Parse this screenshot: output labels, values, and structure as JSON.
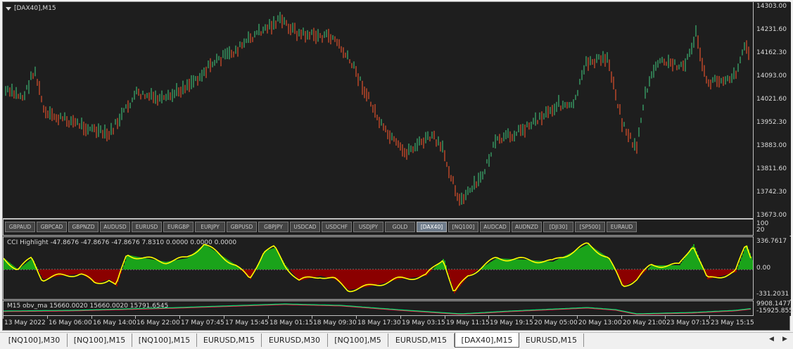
{
  "chart": {
    "title": "[DAX40],M15",
    "price_axis": [
      "14303.00",
      "14231.60",
      "14162.30",
      "14093.00",
      "14021.60",
      "13952.30",
      "13883.00",
      "13811.60",
      "13742.30",
      "13673.00"
    ],
    "symbols": [
      "GBPAUD",
      "GBPCAD",
      "GBPNZD",
      "AUDUSD",
      "EURUSD",
      "EURGBP",
      "EURJPY",
      "GBPUSD",
      "GBPJPY",
      "USDCAD",
      "USDCHF",
      "USDJPY",
      "GOLD",
      "[DAX40]",
      "[NQ100]",
      "AUDCAD",
      "AUDNZD",
      "[DJI30]",
      "[SP500]",
      "EURAUD"
    ],
    "active_symbol": "[DAX40]",
    "symbols_scale": [
      "100",
      "20"
    ],
    "cci_title": "CCI Highlight -47.8676 -47.8676 -47.8676 7.8310 0.0000 0.0000 0.0000",
    "cci_axis": [
      "336.7617",
      "0.00",
      "-331.2031"
    ],
    "obv_title": "M15 obv_ma 15660.0020 15660.0020 15791.6545",
    "obv_axis": [
      "9908.1477",
      "-15925.855"
    ],
    "time_labels": [
      "13 May 2022",
      "16 May 06:00",
      "16 May 14:00",
      "16 May 22:00",
      "17 May 07:45",
      "17 May 15:45",
      "18 May 01:15",
      "18 May 09:30",
      "18 May 17:30",
      "19 May 03:15",
      "19 May 11:15",
      "19 May 19:15",
      "20 May 05:00",
      "20 May 13:00",
      "20 May 21:00",
      "23 May 07:15",
      "23 May 15:15"
    ],
    "colors": {
      "bull": "#3cb371",
      "bear": "#e0512b",
      "cci_pos": "#1aa31a",
      "cci_neg": "#8b0000",
      "cci_line": "#ffff00",
      "obv_line": "#00e070",
      "obv_ma": "#ff2050"
    }
  },
  "tabs": [
    "[NQ100],M30",
    "[NQ100],M15",
    "[NQ100],M15",
    "EURUSD,M15",
    "EURUSD,M30",
    "[NQ100],M5",
    "EURUSD,M15",
    "[DAX40],M15",
    "EURUSD,M15"
  ],
  "active_tab": "[DAX40],M15",
  "scroll": {
    "left": "◀",
    "right": "▶"
  }
}
